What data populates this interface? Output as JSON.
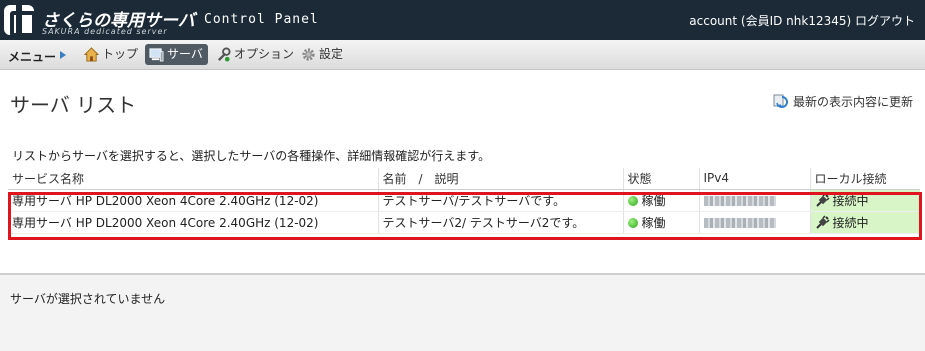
{
  "header": {
    "logo_text": "さくらの専用サーバ",
    "logo_sub": "SAKURA dedicated server",
    "product": "Control Panel",
    "account": "account (会員ID nhk12345) ログアウト"
  },
  "menu": {
    "label": "メニュー",
    "items": [
      {
        "label": "トップ",
        "icon": "home-icon"
      },
      {
        "label": "サーバ",
        "icon": "server-icon"
      },
      {
        "label": "オプション",
        "icon": "wrench-icon"
      },
      {
        "label": "設定",
        "icon": "gear-icon"
      }
    ],
    "active": "サーバ"
  },
  "page": {
    "title": "サーバ リスト",
    "refresh_label": "最新の表示内容に更新",
    "description": "リストからサーバを選択すると、選択したサーバの各種操作、詳細情報確認が行えます。"
  },
  "table": {
    "columns": [
      "サービス名称",
      "名前　/　説明",
      "状態",
      "IPv4",
      "ローカル接続"
    ],
    "rows": [
      {
        "service": "専用サーバ HP DL2000 Xeon 4Core 2.40GHz (12-02)",
        "name": "テストサーバ/テストサーバです。",
        "status": "稼働",
        "ipv4": "",
        "local": "接続中"
      },
      {
        "service": "専用サーバ HP DL2000 Xeon 4Core 2.40GHz (12-02)",
        "name": "テストサーバ2/ テストサーバ2です。",
        "status": "稼働",
        "ipv4": "",
        "local": "接続中"
      }
    ]
  },
  "footer": {
    "message": "サーバが選択されていません"
  },
  "colors": {
    "header_bg": "#1b2a36",
    "highlight_border": "#e0141c",
    "local_connected_bg": "#d7f5c6",
    "status_green": "#2da51a"
  }
}
